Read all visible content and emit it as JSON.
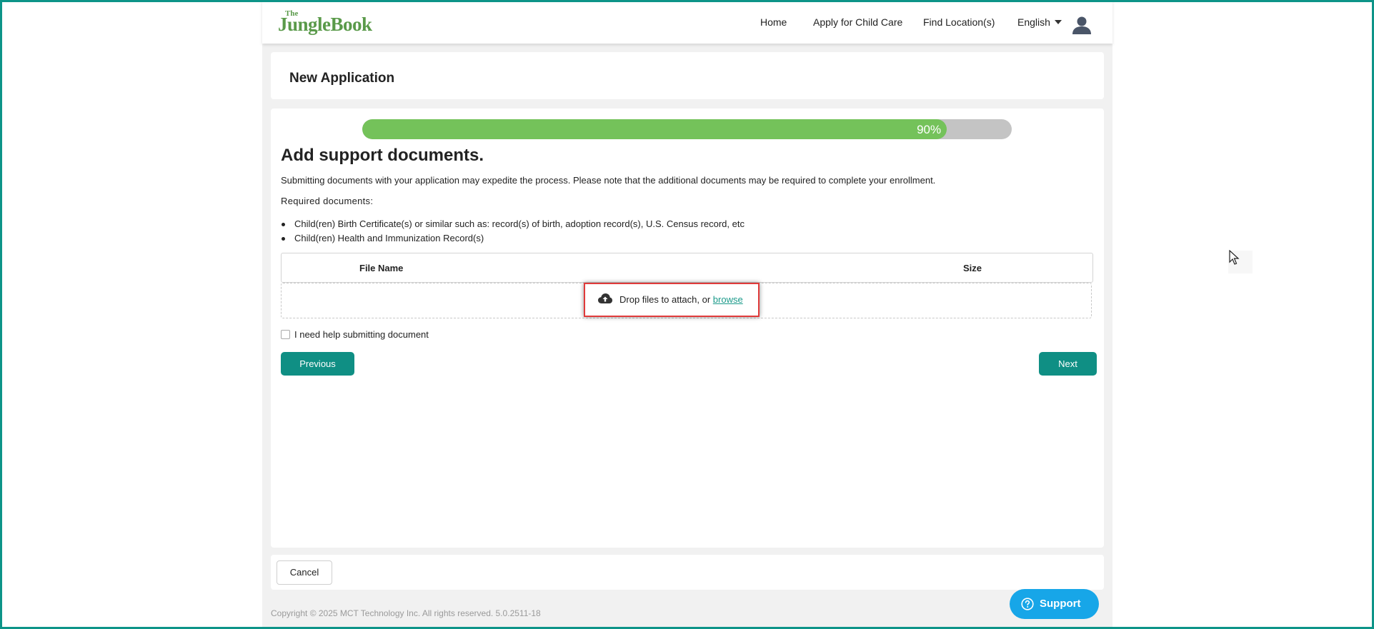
{
  "header": {
    "logo_the": "The",
    "logo_main": "JungleBook",
    "nav": {
      "home": "Home",
      "apply": "Apply for Child Care",
      "find": "Find Location(s)",
      "language": "English"
    }
  },
  "page_title": "New Application",
  "progress": {
    "value": 0.9,
    "label": "90%",
    "fill_color": "#74c25a",
    "track_color": "#c4c4c4"
  },
  "section": {
    "title": "Add support documents.",
    "description": "Submitting documents with your application may expedite the process. Please note that the additional documents may be required to complete your enrollment.",
    "required_label": "Required documents:",
    "required_items": [
      "Child(ren) Birth Certificate(s) or similar such as: record(s) of birth, adoption record(s), U.S. Census record, etc",
      "Child(ren) Health and Immunization Record(s)"
    ]
  },
  "table": {
    "col_file_name": "File Name",
    "col_size": "Size"
  },
  "dropzone": {
    "text": "Drop files to attach, or ",
    "browse": "browse"
  },
  "help_checkbox": {
    "label": "I need help submitting document",
    "checked": false
  },
  "buttons": {
    "previous": "Previous",
    "next": "Next",
    "cancel": "Cancel"
  },
  "footer": {
    "copyright": "Copyright © 2025 MCT Technology Inc. All rights reserved. 5.0.2511-18"
  },
  "support": {
    "label": "Support"
  },
  "colors": {
    "primary": "#0f8f84",
    "support": "#17a6e8",
    "highlight": "#e03a3a",
    "frame": "#0d9488"
  }
}
